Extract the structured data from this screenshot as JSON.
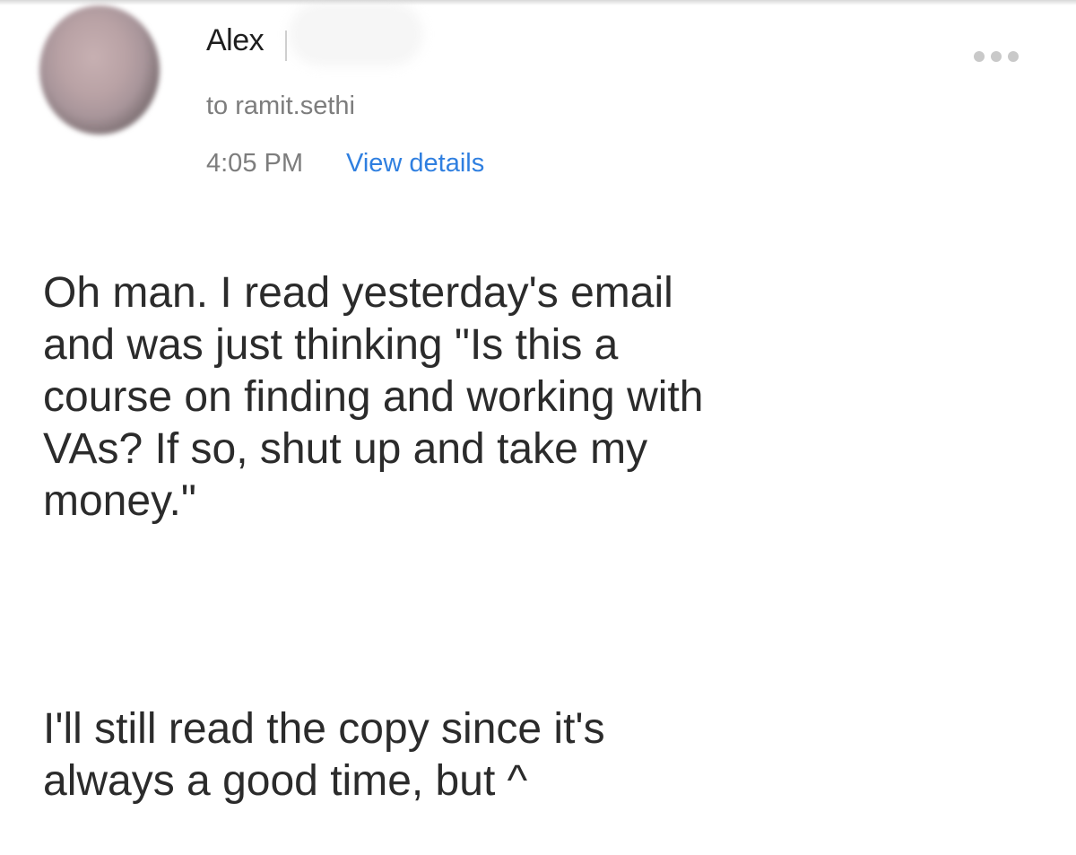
{
  "email": {
    "sender_name": "Alex",
    "recipient": "to ramit.sethi",
    "time": "4:05 PM",
    "view_details_label": "View details",
    "more_icon": "ellipsis-horizontal"
  },
  "message": {
    "paragraphs": [
      "Oh man.  I read yesterday's email\nand was just thinking \"Is this a\ncourse on finding and working with\nVAs?  If so, shut up and take my\nmoney.\"",
      "I'll still read the copy since it's\nalways a good time, but ^"
    ]
  },
  "colors": {
    "link": "#2f7fe0",
    "meta_text": "#7d7d7d",
    "body_text": "#2b2b2b"
  }
}
